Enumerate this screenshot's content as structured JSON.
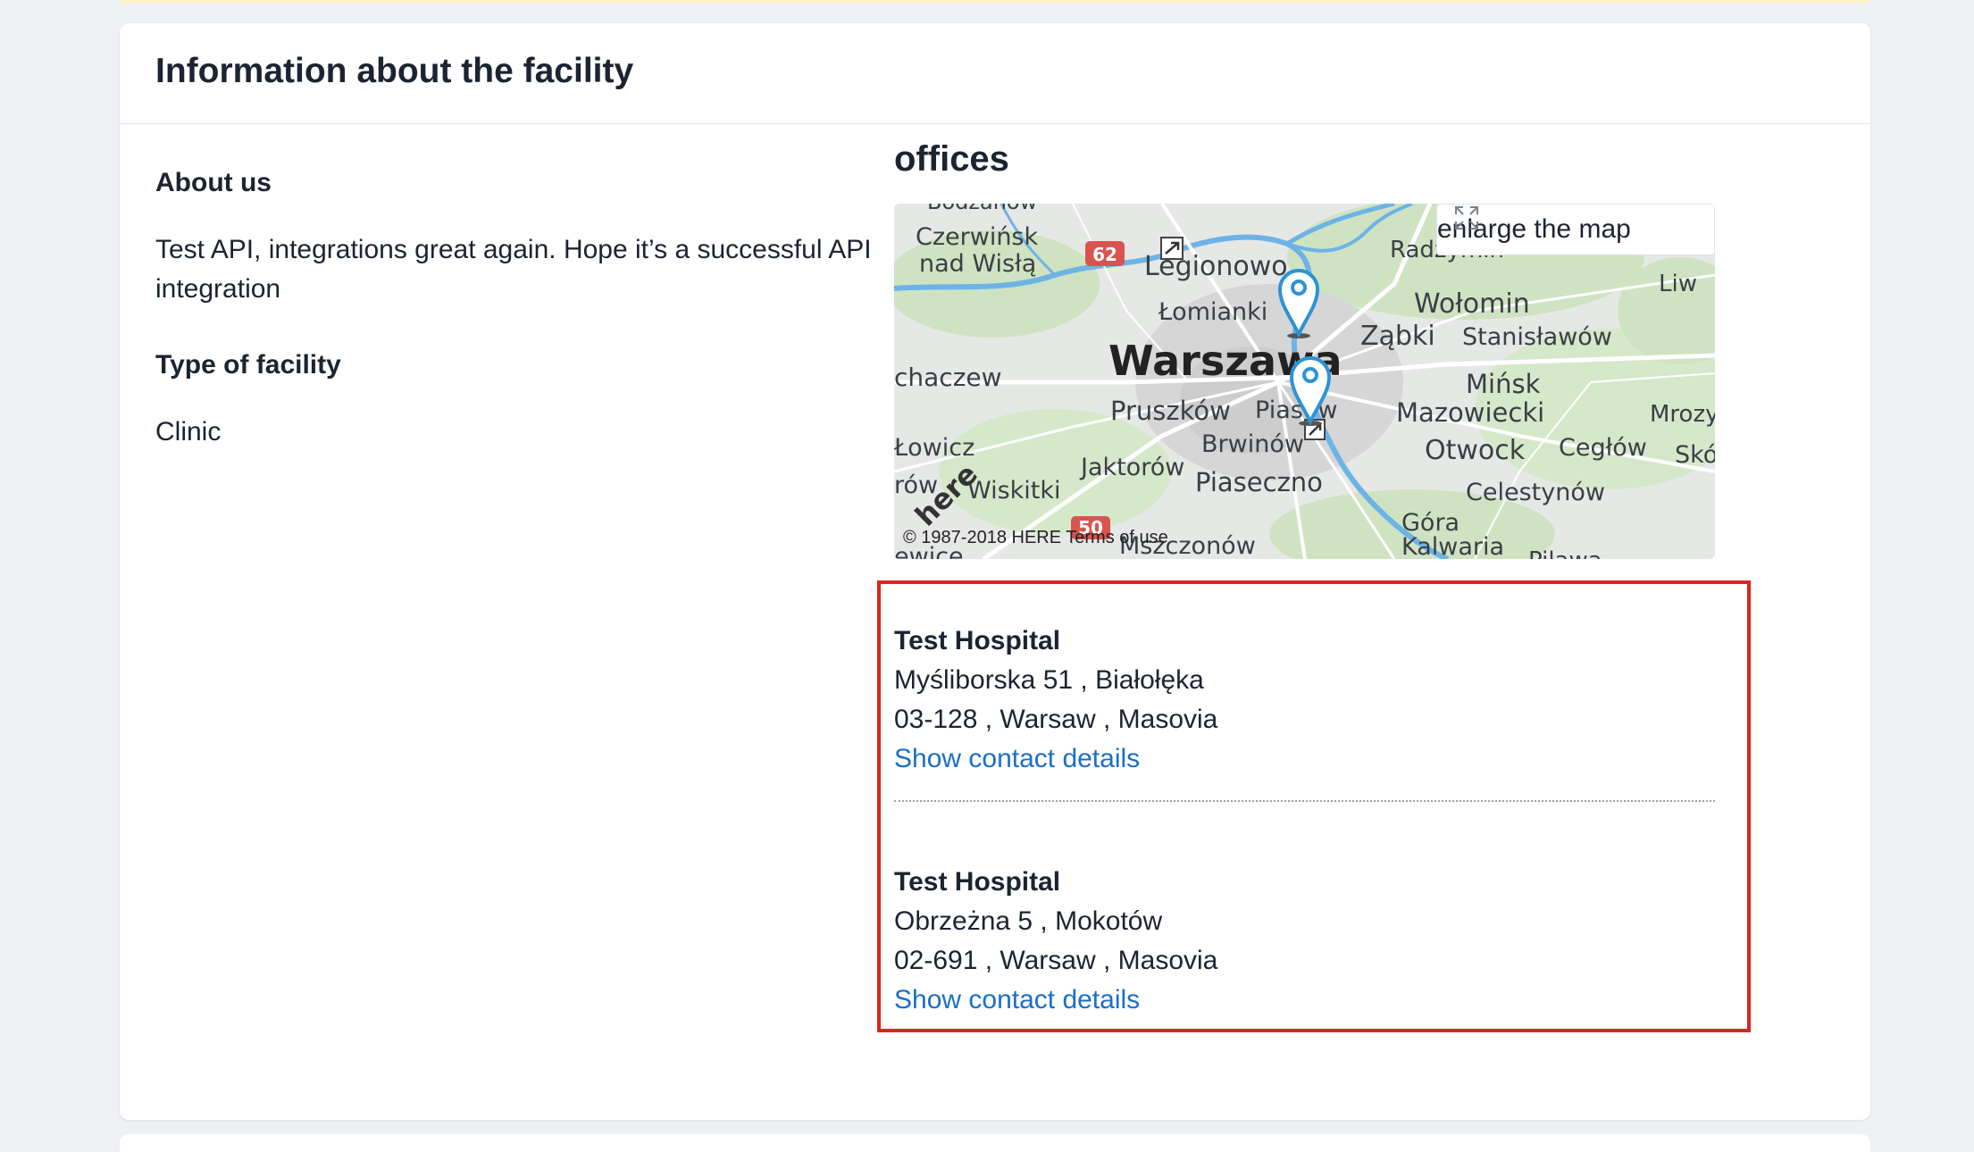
{
  "header": {
    "title": "Information about the facility"
  },
  "about": {
    "label": "About us",
    "text": "Test API, integrations great again. Hope it’s a successful API integration"
  },
  "facility_type": {
    "label": "Type of facility",
    "value": "Clinic"
  },
  "offices": {
    "title": "offices",
    "map": {
      "enlarge_label": "enlarge the map",
      "copyright": "© 1987-2018 HERE Terms of use",
      "logo_text": "here",
      "places": {
        "bodzanow": "Bodzanów",
        "czerwinsk": "Czerwińsk",
        "nad_wisla": "nad Wisłą",
        "legionowo": "Legionowo",
        "radzymin": "Radzymin",
        "liw": "Liw",
        "lomianki": "Łomianki",
        "wolomin": "Wołomin",
        "zabki": "Ząbki",
        "stanislawow": "Stanisławów",
        "warszawa": "Warszawa",
        "sochaczew": "chaczew",
        "minsk": "Mińsk",
        "mazowiecki": "Mazowiecki",
        "mrozy": "Mrozy",
        "pruszkow": "Pruszków",
        "piaseczno_short": "Piasów",
        "lowicz": "Łowicz",
        "brwinow": "Brwinów",
        "otwock": "Otwock",
        "ceglow": "Cegłów",
        "sko": "Skó",
        "jaktorow": "Jaktorów",
        "row": "rów",
        "wiskitki": "Wiskitki",
        "piaseczno": "Piaseczno",
        "celestynow": "Celestynów",
        "gora": "Góra",
        "kalwaria": "Kalwaria",
        "mszczonow": "Mszczonów",
        "ewice": "ewice",
        "pilawa": "Pilawa"
      },
      "road_signs": [
        "62",
        "50"
      ],
      "colors": {
        "water": "#6db3e6",
        "forest": "#cfe3c2",
        "land": "#e6e8e6",
        "urban": "#d3d3d3",
        "road": "#ffffff",
        "pin": "#2e93d6",
        "road_sign": "#d9534f"
      }
    },
    "list": [
      {
        "name": "Test Hospital",
        "street": "Myśliborska 51 , Białołęka",
        "city": "03-128 , Warsaw , Masovia",
        "link": "Show contact details"
      },
      {
        "name": "Test Hospital",
        "street": "Obrzeżna 5 , Mokotów",
        "city": "02-691 , Warsaw , Masovia",
        "link": "Show contact details"
      }
    ]
  }
}
